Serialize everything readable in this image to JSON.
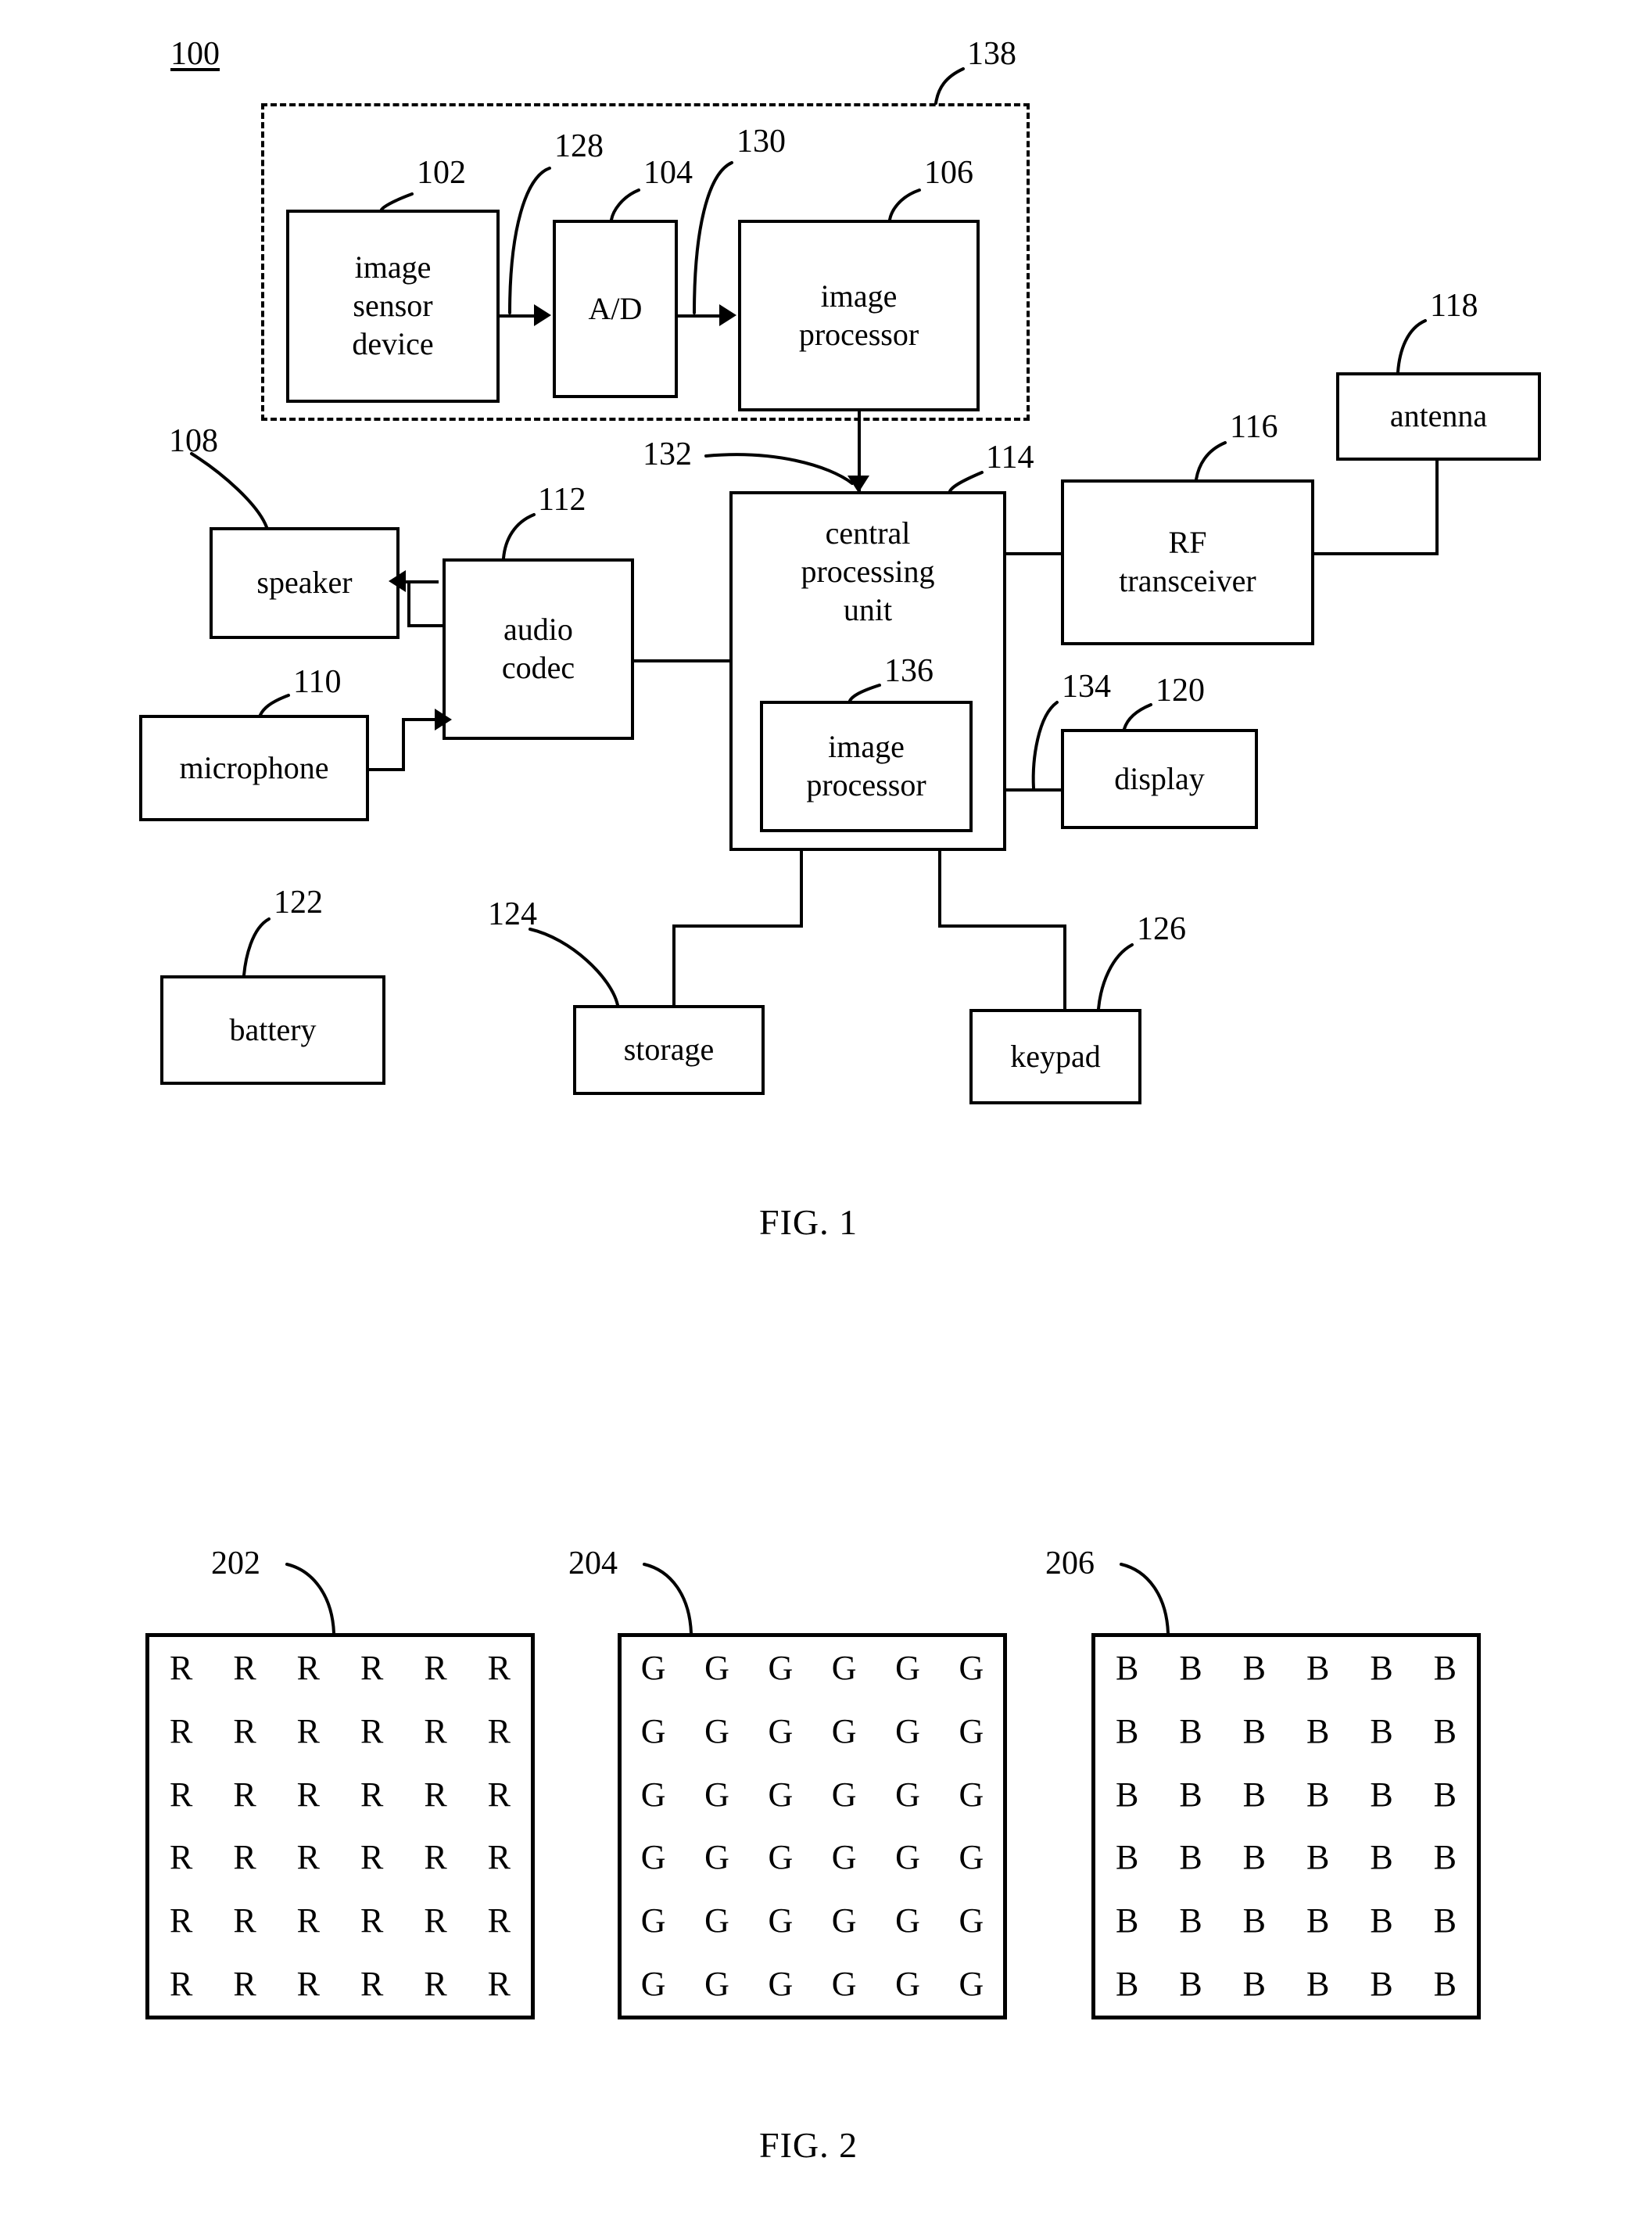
{
  "figures": [
    {
      "id": "fig1",
      "caption": "FIG. 1",
      "system_ref": "100",
      "dashed_group_ref": "138",
      "blocks": [
        {
          "key": "image_sensor_device",
          "label": "image\nsensor\ndevice",
          "ref": "102"
        },
        {
          "key": "ad_converter",
          "label": "A/D",
          "ref": "104"
        },
        {
          "key": "image_processor_top",
          "label": "image\nprocessor",
          "ref": "106"
        },
        {
          "key": "speaker",
          "label": "speaker",
          "ref": "108"
        },
        {
          "key": "microphone",
          "label": "microphone",
          "ref": "110"
        },
        {
          "key": "audio_codec",
          "label": "audio\ncodec",
          "ref": "112"
        },
        {
          "key": "central_processing_unit",
          "label": "central\nprocessing\nunit",
          "ref": "114"
        },
        {
          "key": "rf_transceiver",
          "label": "RF\ntransceiver",
          "ref": "116"
        },
        {
          "key": "antenna",
          "label": "antenna",
          "ref": "118"
        },
        {
          "key": "display",
          "label": "display",
          "ref": "120"
        },
        {
          "key": "battery",
          "label": "battery",
          "ref": "122"
        },
        {
          "key": "storage",
          "label": "storage",
          "ref": "124"
        },
        {
          "key": "keypad",
          "label": "keypad",
          "ref": "126"
        },
        {
          "key": "image_processor_cpu",
          "label": "image\nprocessor",
          "ref": "136"
        }
      ],
      "connection_refs": [
        {
          "key": "sensor_to_ad",
          "ref": "128"
        },
        {
          "key": "ad_to_ip",
          "ref": "130"
        },
        {
          "key": "ip_to_cpu",
          "ref": "132"
        },
        {
          "key": "cpu_to_display",
          "ref": "134"
        }
      ],
      "labels": {
        "image_sensor_device_line1": "image",
        "image_sensor_device_line2": "sensor",
        "image_sensor_device_line3": "device",
        "ad_converter": "A/D",
        "image_processor_top_line1": "image",
        "image_processor_top_line2": "processor",
        "speaker": "speaker",
        "microphone": "microphone",
        "audio_codec_line1": "audio",
        "audio_codec_line2": "codec",
        "cpu_line1": "central",
        "cpu_line2": "processing",
        "cpu_line3": "unit",
        "rf_line1": "RF",
        "rf_line2": "transceiver",
        "antenna": "antenna",
        "display": "display",
        "battery": "battery",
        "storage": "storage",
        "keypad": "keypad",
        "image_processor_cpu_line1": "image",
        "image_processor_cpu_line2": "processor"
      },
      "refs": {
        "r100": "100",
        "r102": "102",
        "r104": "104",
        "r106": "106",
        "r108": "108",
        "r110": "110",
        "r112": "112",
        "r114": "114",
        "r116": "116",
        "r118": "118",
        "r120": "120",
        "r122": "122",
        "r124": "124",
        "r126": "126",
        "r128": "128",
        "r130": "130",
        "r132": "132",
        "r134": "134",
        "r136": "136",
        "r138": "138"
      }
    },
    {
      "id": "fig2",
      "caption": "FIG. 2",
      "grids": [
        {
          "key": "red_plane",
          "ref": "202",
          "symbol": "R",
          "rows": 6,
          "cols": 6
        },
        {
          "key": "green_plane",
          "ref": "204",
          "symbol": "G",
          "rows": 6,
          "cols": 6
        },
        {
          "key": "blue_plane",
          "ref": "206",
          "symbol": "B",
          "rows": 6,
          "cols": 6
        }
      ],
      "refs": {
        "r202": "202",
        "r204": "204",
        "r206": "206"
      }
    }
  ],
  "style": {
    "ink": "#000000",
    "paper": "#ffffff"
  }
}
